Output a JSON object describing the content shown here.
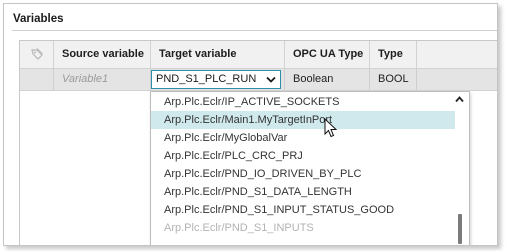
{
  "panel": {
    "title": "Variables"
  },
  "table": {
    "columns": {
      "source": "Source variable",
      "target": "Target variable",
      "opcua_type": "OPC UA Type",
      "type": "Type"
    },
    "row": {
      "source": "Variable1",
      "target": "PND_S1_PLC_RUN",
      "opcua_type": "Boolean",
      "type": "BOOL"
    }
  },
  "dropdown": {
    "items": [
      "Arp.Plc.Eclr/IP_ACTIVE_SOCKETS",
      "Arp.Plc.Eclr/Main1.MyTargetInPort",
      "Arp.Plc.Eclr/MyGlobalVar",
      "Arp.Plc.Eclr/PLC_CRC_PRJ",
      "Arp.Plc.Eclr/PND_IO_DRIVEN_BY_PLC",
      "Arp.Plc.Eclr/PND_S1_DATA_LENGTH",
      "Arp.Plc.Eclr/PND_S1_INPUT_STATUS_GOOD",
      "Arp.Plc.Eclr/PND_S1_INPUTS"
    ],
    "hovered_index": 1
  },
  "icons": {
    "header_icon": "row-settings-icon",
    "combo_arrow": "chevron-down-icon",
    "scroll_up": "chevron-up-icon",
    "cursor": "mouse-pointer-icon"
  },
  "colors": {
    "hover": "#cfe9ed",
    "combo_border": "#2e8fa8",
    "row_bg": "#e4e4e4",
    "header_bg": "#f1f1f1"
  }
}
